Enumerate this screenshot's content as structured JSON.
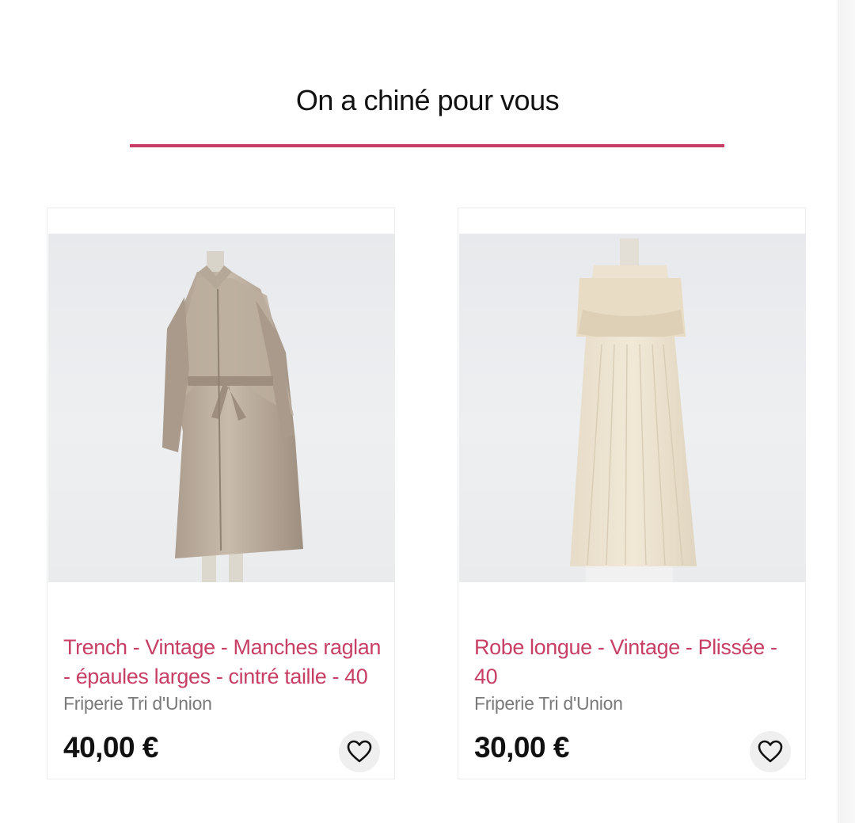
{
  "section": {
    "title": "On a chiné pour vous"
  },
  "colors": {
    "accent": "#c83f66",
    "price": "#111111",
    "seller": "#7a7a7a"
  },
  "products": [
    {
      "title_line1": "Trench - Vintage - Manches raglan",
      "title_line2": "- épaules larges - cintré taille - 40",
      "seller": "Friperie Tri d'Union",
      "price": "40,00 €",
      "favorite_icon": "heart-outline-icon"
    },
    {
      "title_line1": "Robe longue - Vintage - Plissée -",
      "title_line2": "40",
      "seller": "Friperie Tri d'Union",
      "price": "30,00 €",
      "favorite_icon": "heart-outline-icon"
    }
  ]
}
